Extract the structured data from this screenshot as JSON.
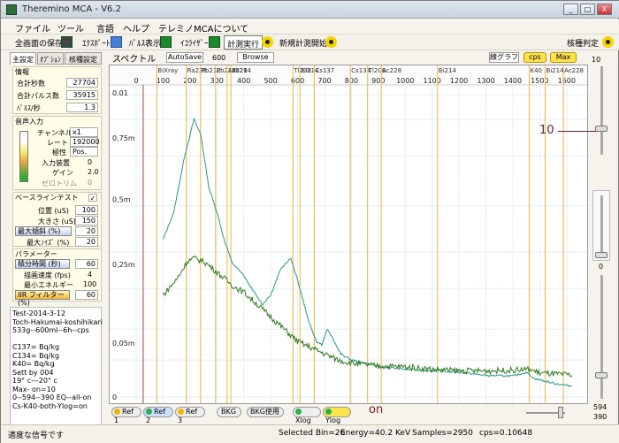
{
  "window": {
    "title": "Theremino MCA - V6.2",
    "min": "_",
    "max": "□",
    "close": "X"
  },
  "menu": [
    "ファイル",
    "ツール",
    "言語",
    "ヘルプ",
    "テレミノMCAについて"
  ],
  "toolbar": {
    "save": "全画面の保存",
    "export": "ｴｸｽﾎﾟｰﾄ",
    "pulse": "ﾊﾟﾙｽ表示",
    "equalizer": "ｲｺﾗｲｻﾞｰ",
    "run": "計測実行",
    "new": "新規計測開始",
    "nuclide": "核種判定"
  },
  "tabs": [
    "主設定",
    "ｵﾌﾟｼｮﾝ",
    "核種設定"
  ],
  "info": {
    "head": "情報",
    "rows": [
      {
        "label": "合計秒数",
        "value": "27704"
      },
      {
        "label": "合計パルス数",
        "value": "35915"
      },
      {
        "label": "ﾊﾟﾙｽ/秒",
        "value": "1.3"
      }
    ]
  },
  "audio": {
    "head": "音声入力",
    "rows": [
      {
        "label": "チャンネル",
        "value": "x1"
      },
      {
        "label": "レート",
        "value": "192000"
      },
      {
        "label": "極性",
        "value": "Pos."
      },
      {
        "label": "入力装置",
        "value": "0"
      },
      {
        "label": "ゲイン",
        "value": "2.0"
      },
      {
        "label": "ゼロトリム",
        "value": "0"
      }
    ]
  },
  "baseline": {
    "head": "ベースラインテスト",
    "rows": [
      {
        "label": "位置 (uS)",
        "value": "100"
      },
      {
        "label": "大きさ (uS)",
        "value": "150"
      },
      {
        "label": "最大傾斜 (%)",
        "value": "20"
      },
      {
        "label": "最大ﾉｲｽﾞ (%)",
        "value": "20"
      }
    ]
  },
  "params": {
    "head": "パラメーター",
    "rows": [
      {
        "label": "積分時間 (秒)",
        "value": "60"
      },
      {
        "label": "描画速度 (fps)",
        "value": "4"
      },
      {
        "label": "最小エネルギー",
        "value": "100"
      },
      {
        "label": "IIR フィルター (%)",
        "value": "60"
      }
    ]
  },
  "notes": [
    "Test-2014-3-12",
    "Toch-Hakumai-koshihikari",
    "533g--600ml--6h--cps",
    "",
    "C137= Bq/kg",
    "C134= Bq/kg",
    "K40= Bq/kg",
    "Sett by 004",
    "19° c---20° c",
    "Max- on=10",
    "0--594--390  EQ--all-on",
    "Cs-K40-both-Ylog=on"
  ],
  "spectrum": {
    "label": "スペクトル",
    "autosave": "AutoSave",
    "autosave_value": "600",
    "browse": "Browse",
    "graph_type": "線グラフ",
    "cps": "cps",
    "max": "Max"
  },
  "chart_data": {
    "type": "line",
    "x_ticks": [
      0,
      100,
      200,
      300,
      400,
      500,
      600,
      700,
      800,
      900,
      1000,
      1100,
      1200,
      1300,
      1400,
      1500,
      1600
    ],
    "y_ticks": [
      "0.01",
      "0,75m",
      "0,5m",
      "0,25m",
      "0,05m",
      "0"
    ],
    "isotopes": [
      {
        "label": "BiXray",
        "e": 77
      },
      {
        "label": "Ra226",
        "e": 186
      },
      {
        "label": "Pb212",
        "e": 239
      },
      {
        "label": "Pb214",
        "e": 295
      },
      {
        "label": "Ac228",
        "e": 338
      },
      {
        "label": "Pb214",
        "e": 352
      },
      {
        "label": "Tl208",
        "e": 583
      },
      {
        "label": "Bi214",
        "e": 609
      },
      {
        "label": "Cs137",
        "e": 662
      },
      {
        "label": "Cs134",
        "e": 796
      },
      {
        "label": "Tl208",
        "e": 860
      },
      {
        "label": "Ac228",
        "e": 911
      },
      {
        "label": "Bi214",
        "e": 1120
      },
      {
        "label": "K40",
        "e": 1461
      },
      {
        "label": "Bi214",
        "e": 1520
      },
      {
        "label": "Ac228",
        "e": 1588
      }
    ],
    "series": [
      {
        "color": "#2a9a86",
        "points": [
          [
            100,
            0.51
          ],
          [
            140,
            0.6
          ],
          [
            180,
            0.78
          ],
          [
            215,
            0.9
          ],
          [
            240,
            0.85
          ],
          [
            270,
            0.68
          ],
          [
            300,
            0.6
          ],
          [
            330,
            0.5
          ],
          [
            360,
            0.43
          ],
          [
            395,
            0.4
          ],
          [
            430,
            0.35
          ],
          [
            470,
            0.3
          ],
          [
            500,
            0.33
          ],
          [
            540,
            0.42
          ],
          [
            575,
            0.45
          ],
          [
            600,
            0.38
          ],
          [
            640,
            0.25
          ],
          [
            670,
            0.18
          ],
          [
            690,
            0.17
          ],
          [
            710,
            0.22
          ],
          [
            730,
            0.19
          ],
          [
            760,
            0.14
          ],
          [
            800,
            0.12
          ],
          [
            900,
            0.1
          ],
          [
            1000,
            0.09
          ],
          [
            1100,
            0.085
          ],
          [
            1200,
            0.08
          ],
          [
            1300,
            0.07
          ],
          [
            1400,
            0.068
          ],
          [
            1450,
            0.08
          ],
          [
            1480,
            0.06
          ],
          [
            1550,
            0.045
          ],
          [
            1620,
            0.035
          ]
        ]
      },
      {
        "color": "#2f7a1e",
        "points": [
          [
            100,
            0.33
          ],
          [
            150,
            0.38
          ],
          [
            190,
            0.44
          ],
          [
            215,
            0.45
          ],
          [
            250,
            0.44
          ],
          [
            280,
            0.42
          ],
          [
            320,
            0.39
          ],
          [
            360,
            0.36
          ],
          [
            400,
            0.34
          ],
          [
            450,
            0.3
          ],
          [
            500,
            0.26
          ],
          [
            550,
            0.22
          ],
          [
            600,
            0.18
          ],
          [
            650,
            0.16
          ],
          [
            700,
            0.14
          ],
          [
            750,
            0.12
          ],
          [
            800,
            0.11
          ],
          [
            900,
            0.1
          ],
          [
            1000,
            0.098
          ],
          [
            1100,
            0.09
          ],
          [
            1200,
            0.085
          ],
          [
            1300,
            0.085
          ],
          [
            1400,
            0.087
          ],
          [
            1460,
            0.09
          ],
          [
            1500,
            0.078
          ],
          [
            1550,
            0.075
          ],
          [
            1620,
            0.07
          ]
        ]
      }
    ]
  },
  "bottom": {
    "ref1": "Ref 1",
    "ref2": "Ref 2",
    "ref3": "Ref 3",
    "bkg": "BKG",
    "bkg_use": "BKG使用",
    "xlog": "Xlog",
    "ylog": "Ylog"
  },
  "annotations": {
    "on": "on",
    "ten": "10"
  },
  "right": {
    "top_val": "10",
    "bot_val": "0",
    "v1": "594",
    "v2": "390"
  },
  "status": {
    "left": "適度な信号です",
    "bin": "Selected Bin=26",
    "energy": "Energy=40.2 KeV",
    "samples": "Samples=2950",
    "cps": "cps=0.10648"
  }
}
